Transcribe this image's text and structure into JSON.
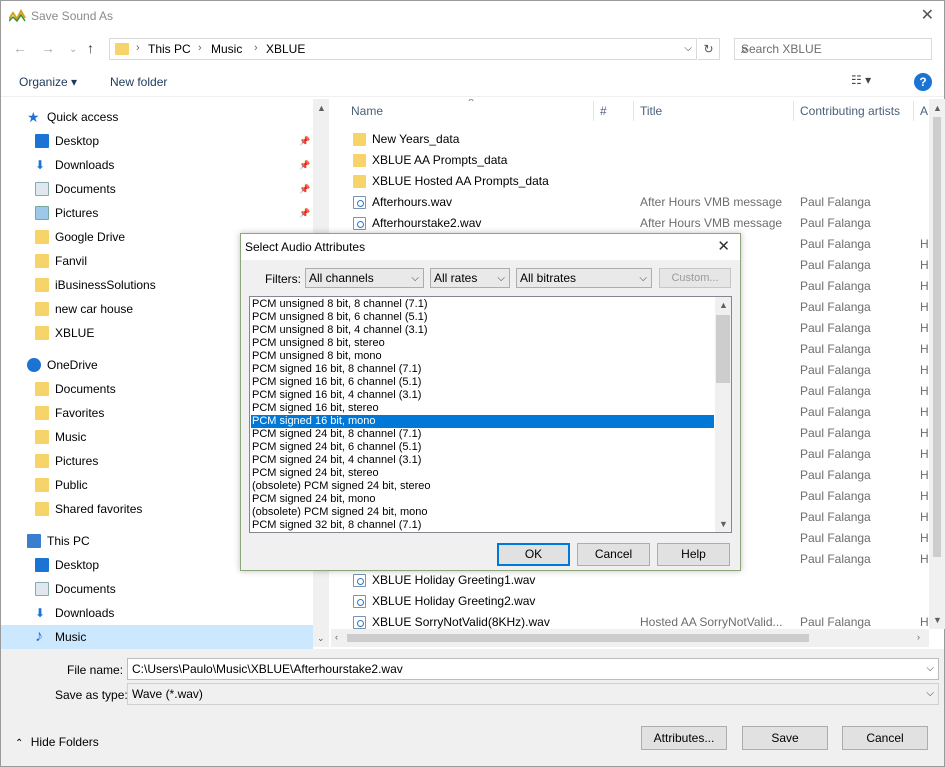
{
  "window": {
    "title": "Save Sound As"
  },
  "address": {
    "crumbs": [
      "This PC",
      "Music",
      "XBLUE"
    ],
    "search_placeholder": "Search XBLUE"
  },
  "toolbar": {
    "organize": "Organize ▾",
    "new_folder": "New folder",
    "help": "?"
  },
  "sidebar": {
    "items": [
      {
        "label": "Quick access",
        "icon": "star-icon",
        "color": "#1b73d4"
      },
      {
        "label": "Desktop",
        "icon": "desktop-icon",
        "pinned": true
      },
      {
        "label": "Downloads",
        "icon": "download-icon",
        "pinned": true
      },
      {
        "label": "Documents",
        "icon": "documents-icon",
        "pinned": true
      },
      {
        "label": "Pictures",
        "icon": "pictures-icon",
        "pinned": true
      },
      {
        "label": "Google Drive",
        "icon": "folder-icon"
      },
      {
        "label": "Fanvil",
        "icon": "folder-icon"
      },
      {
        "label": "iBusinessSolutions",
        "icon": "folder-icon"
      },
      {
        "label": "new car house",
        "icon": "folder-icon"
      },
      {
        "label": "XBLUE",
        "icon": "folder-icon"
      },
      {
        "label": "OneDrive",
        "icon": "cloud-icon"
      },
      {
        "label": "Documents",
        "icon": "folder-icon"
      },
      {
        "label": "Favorites",
        "icon": "folder-icon"
      },
      {
        "label": "Music",
        "icon": "folder-icon"
      },
      {
        "label": "Pictures",
        "icon": "folder-icon"
      },
      {
        "label": "Public",
        "icon": "folder-icon"
      },
      {
        "label": "Shared favorites",
        "icon": "folder-icon"
      },
      {
        "label": "This PC",
        "icon": "computer-icon"
      },
      {
        "label": "Desktop",
        "icon": "desktop-icon"
      },
      {
        "label": "Documents",
        "icon": "documents-icon"
      },
      {
        "label": "Downloads",
        "icon": "download-icon"
      },
      {
        "label": "Music",
        "icon": "music-icon",
        "selected": true
      }
    ]
  },
  "columns": {
    "name": "Name",
    "num": "#",
    "title": "Title",
    "artists": "Contributing artists",
    "more": "A"
  },
  "files": [
    {
      "name": "New Years_data",
      "type": "folder",
      "title": "",
      "artist": "",
      "h": ""
    },
    {
      "name": "XBLUE AA Prompts_data",
      "type": "folder",
      "title": "",
      "artist": "",
      "h": ""
    },
    {
      "name": "XBLUE Hosted AA Prompts_data",
      "type": "folder",
      "title": "",
      "artist": "",
      "h": ""
    },
    {
      "name": "Afterhours.wav",
      "type": "wav",
      "title": "After Hours VMB message",
      "artist": "Paul Falanga",
      "h": ""
    },
    {
      "name": "Afterhourstake2.wav",
      "type": "wav",
      "title": "After Hours VMB message",
      "artist": "Paul Falanga",
      "h": ""
    },
    {
      "name": "",
      "type": "",
      "title": "",
      "artist": "Paul Falanga",
      "h": "H"
    },
    {
      "name": "",
      "type": "",
      "title": "",
      "artist": "Paul Falanga",
      "h": "H"
    },
    {
      "name": "",
      "type": "",
      "title": "",
      "artist": "Paul Falanga",
      "h": "H"
    },
    {
      "name": "",
      "type": "",
      "title": "",
      "artist": "Paul Falanga",
      "h": "H"
    },
    {
      "name": "",
      "type": "",
      "title": "",
      "artist": "Paul Falanga",
      "h": "H"
    },
    {
      "name": "",
      "type": "",
      "title": "",
      "artist": "Paul Falanga",
      "h": "H"
    },
    {
      "name": "",
      "type": "",
      "title": "",
      "artist": "Paul Falanga",
      "h": "H"
    },
    {
      "name": "",
      "type": "",
      "title": "",
      "artist": "Paul Falanga",
      "h": "H"
    },
    {
      "name": "",
      "type": "",
      "title": "",
      "artist": "Paul Falanga",
      "h": "H"
    },
    {
      "name": "",
      "type": "",
      "title": "",
      "artist": "Paul Falanga",
      "h": "H"
    },
    {
      "name": "",
      "type": "",
      "title": "",
      "artist": "Paul Falanga",
      "h": "H"
    },
    {
      "name": "",
      "type": "",
      "title": "",
      "artist": "Paul Falanga",
      "h": "H"
    },
    {
      "name": "",
      "type": "",
      "title": "",
      "artist": "Paul Falanga",
      "h": "H"
    },
    {
      "name": "",
      "type": "",
      "title": "",
      "artist": "Paul Falanga",
      "h": "H"
    },
    {
      "name": "",
      "type": "",
      "title": "",
      "artist": "Paul Falanga",
      "h": "H"
    },
    {
      "name": "",
      "type": "",
      "title": "",
      "artist": "Paul Falanga",
      "h": "H"
    },
    {
      "name": "XBLUE Holiday Greeting1.wav",
      "type": "wav",
      "title": "",
      "artist": "",
      "h": ""
    },
    {
      "name": "XBLUE Holiday Greeting2.wav",
      "type": "wav",
      "title": "",
      "artist": "",
      "h": ""
    },
    {
      "name": "XBLUE SorryNotValid(8KHz).wav",
      "type": "wav",
      "title": "Hosted AA SorryNotValid...",
      "artist": "Paul Falanga",
      "h": "H"
    }
  ],
  "bottom": {
    "file_name_label": "File name:",
    "file_name": "C:\\Users\\Paulo\\Music\\XBLUE\\Afterhourstake2.wav",
    "save_type_label": "Save as type:",
    "save_type": "Wave (*.wav)",
    "hide_folders": "Hide Folders",
    "attributes": "Attributes...",
    "save": "Save",
    "cancel": "Cancel"
  },
  "dialog": {
    "title": "Select Audio Attributes",
    "filters_label": "Filters:",
    "channels": "All channels",
    "rates": "All rates",
    "bitrates": "All bitrates",
    "custom": "Custom...",
    "ok": "OK",
    "cancel": "Cancel",
    "help": "Help",
    "selected_index": 9,
    "formats": [
      "PCM unsigned 8 bit, 8 channel (7.1)",
      "PCM unsigned 8 bit, 6 channel (5.1)",
      "PCM unsigned 8 bit, 4 channel (3.1)",
      "PCM unsigned 8 bit, stereo",
      "PCM unsigned 8 bit, mono",
      "PCM signed 16 bit, 8 channel (7.1)",
      "PCM signed 16 bit, 6 channel (5.1)",
      "PCM signed 16 bit, 4 channel (3.1)",
      "PCM signed 16 bit, stereo",
      "PCM signed 16 bit, mono",
      "PCM signed 24 bit, 8 channel (7.1)",
      "PCM signed 24 bit, 6 channel (5.1)",
      "PCM signed 24 bit, 4 channel (3.1)",
      "PCM signed 24 bit, stereo",
      "(obsolete) PCM signed 24 bit, stereo",
      "PCM signed 24 bit, mono",
      "(obsolete) PCM signed 24 bit, mono",
      "PCM signed 32 bit, 8 channel (7.1)"
    ]
  }
}
